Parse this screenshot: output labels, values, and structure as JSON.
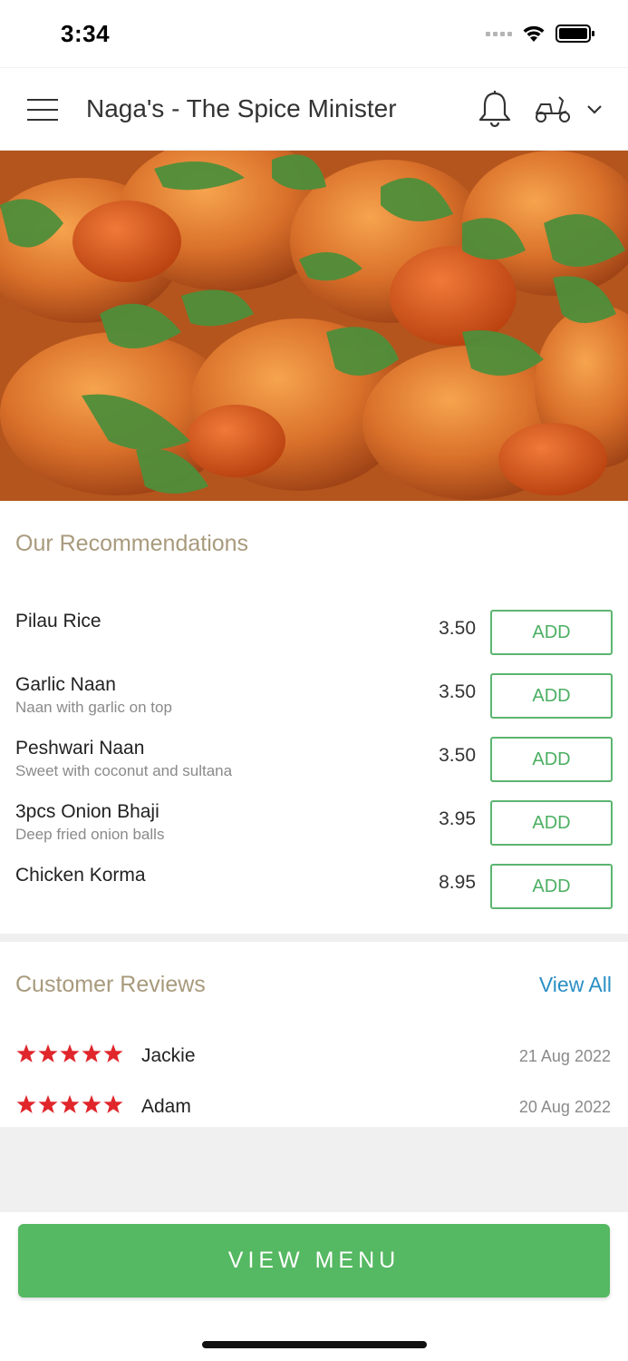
{
  "status_bar": {
    "time": "3:34"
  },
  "header": {
    "title": "Naga's - The Spice Minister",
    "icons": [
      "menu-icon",
      "bell-icon",
      "scooter-icon",
      "chevron-down-icon"
    ]
  },
  "recommendations": {
    "title": "Our Recommendations",
    "items": [
      {
        "name": "Pilau Rice",
        "description": "",
        "price": "3.50",
        "button": "ADD"
      },
      {
        "name": "Garlic Naan",
        "description": "Naan with garlic on top",
        "price": "3.50",
        "button": "ADD"
      },
      {
        "name": "Peshwari Naan",
        "description": "Sweet with coconut and sultana",
        "price": "3.50",
        "button": "ADD"
      },
      {
        "name": "3pcs Onion Bhaji",
        "description": "Deep fried onion balls",
        "price": "3.95",
        "button": "ADD"
      },
      {
        "name": "Chicken Korma",
        "description": "",
        "price": "8.95",
        "button": "ADD"
      }
    ]
  },
  "reviews": {
    "title": "Customer Reviews",
    "view_all": "View All",
    "items": [
      {
        "rating": 5,
        "name": "Jackie",
        "date": "21 Aug 2022"
      },
      {
        "rating": 5,
        "name": "Adam",
        "date": "20 Aug 2022"
      }
    ]
  },
  "footer": {
    "view_menu": "VIEW MENU"
  },
  "colors": {
    "accent_green": "#55b862",
    "section_title": "#a89a7c",
    "link_blue": "#2a8fc4",
    "star_red": "#e0262b"
  }
}
